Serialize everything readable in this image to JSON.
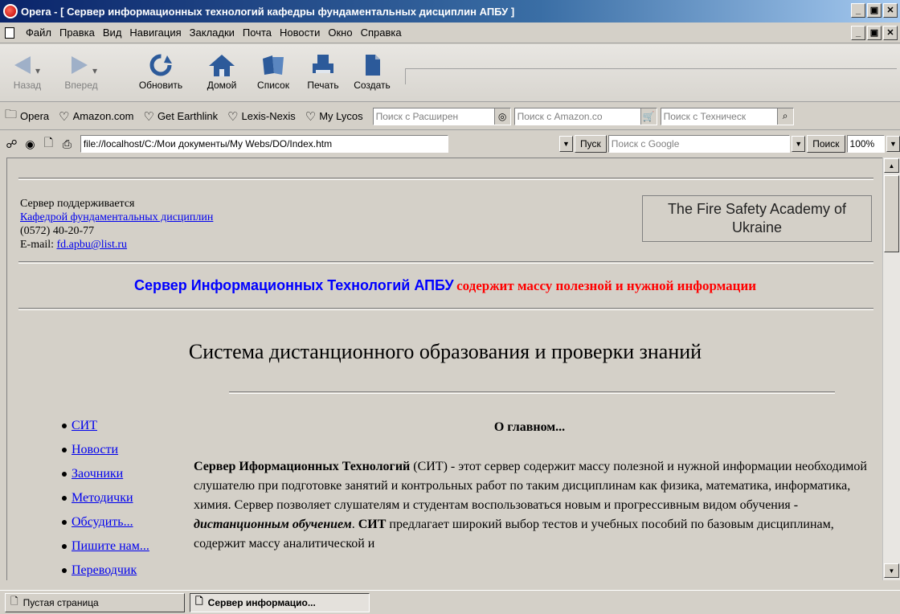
{
  "window": {
    "title": "Opera - [ Сервер информационных технологий кафедры фундаментальных дисциплин АПБУ ]"
  },
  "menu": {
    "items": [
      "Файл",
      "Правка",
      "Вид",
      "Навигация",
      "Закладки",
      "Почта",
      "Новости",
      "Окно",
      "Справка"
    ]
  },
  "toolbar": {
    "back": "Назад",
    "forward": "Вперед",
    "reload": "Обновить",
    "home": "Домой",
    "list": "Список",
    "print": "Печать",
    "create": "Создать"
  },
  "bookmarks": {
    "items": [
      "Opera",
      "Amazon.com",
      "Get Earthlink",
      "Lexis-Nexis",
      "My Lycos"
    ],
    "search1": "Поиск с Расширен",
    "search2": "Поиск с Amazon.co",
    "search3": "Поиск с Техническ"
  },
  "address": {
    "url": "file://localhost/C:/Мои документы/My Webs/DO/Index.htm",
    "go": "Пуск",
    "google_placeholder": "Поиск с Google",
    "search_btn": "Поиск",
    "zoom": "100%"
  },
  "page": {
    "support_line1": "Сервер поддерживается",
    "support_link": "Кафедрой фундаментальных дисциплин",
    "phone": "(0572) 40-20-77",
    "email_label": "E-mail: ",
    "email": "fd.apbu@list.ru",
    "academy": "The Fire Safety Academy of Ukraine",
    "banner_blue": "Сервер Информационных Технологий АПБУ",
    "banner_red": "содержит массу полезной и нужной информации",
    "heading": "Система дистанционного образования и проверки знаний",
    "nav": [
      "СИТ",
      "Новости",
      "Заочники",
      "Методички",
      "Обсудить...",
      "Пишите нам...",
      "Переводчик"
    ],
    "section_title": "О главном...",
    "p_bold1": "Сервер Иформационных Технологий",
    "p_text1": " (СИТ) - этот сервер содержит массу полезной и нужной информации необходимой слушателю при подготовке занятий и контрольных работ по таким дисциплинам как физика, математика, информатика, химия. Сервер позволяет слушателям и студентам воспользоваться новым и прогрессивным видом обучения - ",
    "p_em": "дистанционным обучением",
    "p_text2": ". ",
    "p_bold2": "СИТ",
    "p_text3": " предлагает широкий выбор тестов и учебных пособий по базовым дисциплинам, содержит массу аналитической и"
  },
  "taskbar": {
    "tab1": "Пустая страница",
    "tab2": "Сервер информацио..."
  }
}
